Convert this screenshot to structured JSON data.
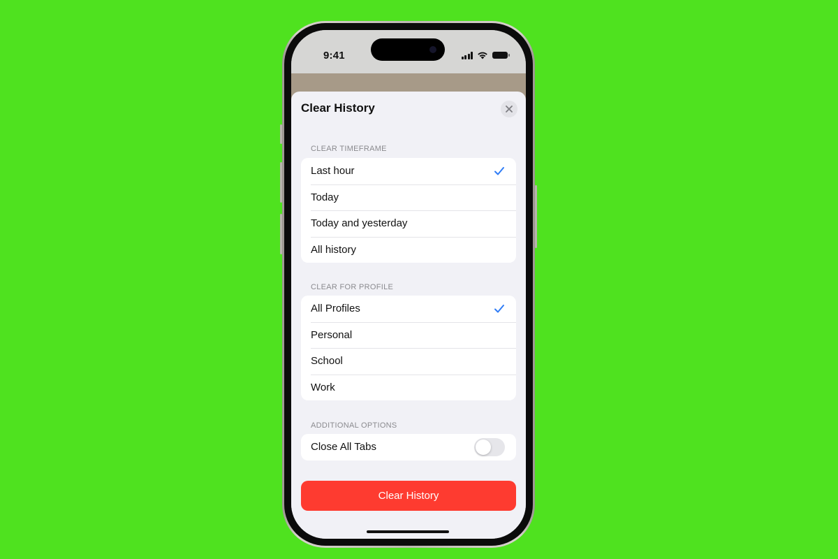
{
  "status_bar": {
    "time": "9:41",
    "icons": [
      "signal-icon",
      "wifi-icon",
      "battery-icon"
    ]
  },
  "sheet": {
    "title": "Clear History",
    "close_icon": "close-icon"
  },
  "timeframe": {
    "header": "CLEAR TIMEFRAME",
    "options": [
      {
        "label": "Last hour",
        "selected": true
      },
      {
        "label": "Today",
        "selected": false
      },
      {
        "label": "Today and yesterday",
        "selected": false
      },
      {
        "label": "All history",
        "selected": false
      }
    ]
  },
  "profile": {
    "header": "CLEAR FOR PROFILE",
    "options": [
      {
        "label": "All Profiles",
        "selected": true
      },
      {
        "label": "Personal",
        "selected": false
      },
      {
        "label": "School",
        "selected": false
      },
      {
        "label": "Work",
        "selected": false
      }
    ]
  },
  "additional": {
    "header": "ADDITIONAL OPTIONS",
    "close_all_tabs": {
      "label": "Close All Tabs",
      "on": false
    }
  },
  "action": {
    "clear_button": "Clear History"
  },
  "colors": {
    "background": "#4fe21f",
    "accent": "#2f7cf6",
    "destructive": "#fe3b30"
  }
}
